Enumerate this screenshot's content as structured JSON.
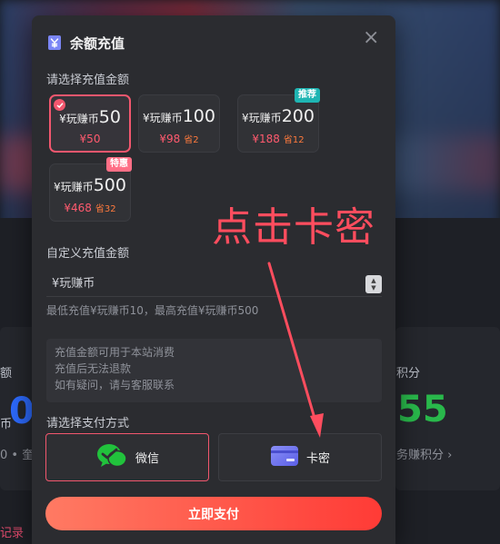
{
  "background": {
    "left_label": "额",
    "left_unit": "币",
    "left_footer": "0 • 奎",
    "right_label": "积分",
    "right_value": "55",
    "right_footer": "务赚积分 ›",
    "records_label": "记录"
  },
  "modal": {
    "title": "余额充值",
    "close_symbol": "×",
    "select_amount_label": "请选择充值金额",
    "amounts": [
      {
        "currency_symbol": "¥",
        "unit": "玩赚币",
        "value": "50",
        "price": "¥50",
        "save": "",
        "tag": "",
        "selected": true
      },
      {
        "currency_symbol": "¥",
        "unit": "玩赚币",
        "value": "100",
        "price": "¥98",
        "save": "省2",
        "tag": "",
        "selected": false
      },
      {
        "currency_symbol": "¥",
        "unit": "玩赚币",
        "value": "200",
        "price": "¥188",
        "save": "省12",
        "tag": "推荐",
        "selected": false
      },
      {
        "currency_symbol": "¥",
        "unit": "玩赚币",
        "value": "500",
        "price": "¥468",
        "save": "省32",
        "tag": "特惠",
        "selected": false
      }
    ],
    "custom_amount_label": "自定义充值金额",
    "custom_input_placeholder": "¥玩赚币",
    "custom_input_hint": "最低充值¥玩赚币10，最高充值¥玩赚币500",
    "notice_lines": [
      "充值金额可用于本站消费",
      "充值后无法退款",
      "如有疑问，请与客服联系"
    ],
    "payment_label": "请选择支付方式",
    "payment_methods": [
      {
        "label": "微信",
        "icon": "wechat-icon",
        "selected": true
      },
      {
        "label": "卡密",
        "icon": "card-icon",
        "selected": false
      }
    ],
    "submit_label": "立即支付"
  },
  "annotation": {
    "text": "点击卡密"
  },
  "colors": {
    "accent": "#f2576e",
    "price": "#ff5a6e",
    "save": "#ff7a3d",
    "tag_recommend": "#1fb5b3",
    "tag_special": "#ff6f86",
    "wechat": "#21c23c",
    "card": "#6f74f0",
    "submit_start": "#ff7a63",
    "submit_end": "#ff3b36"
  }
}
